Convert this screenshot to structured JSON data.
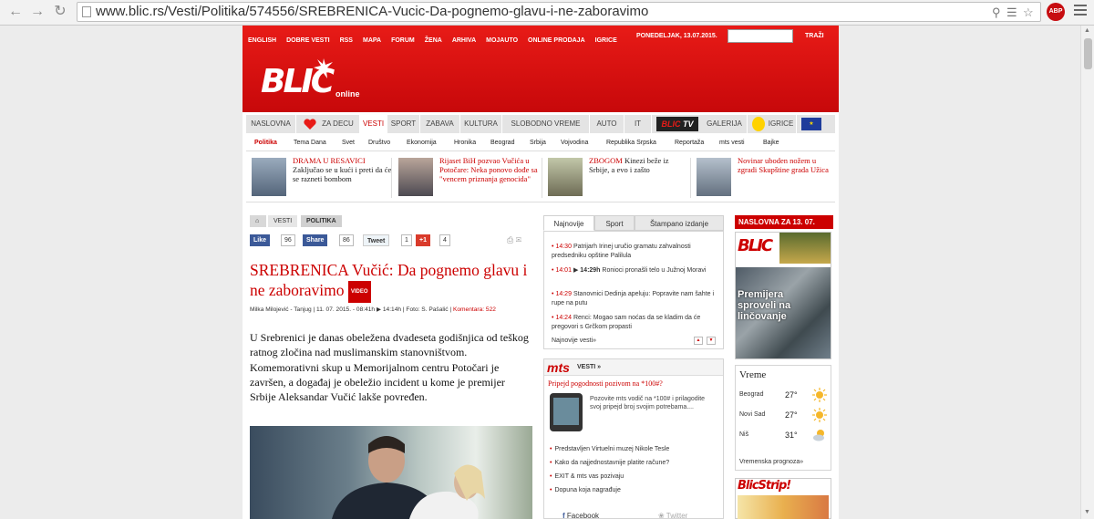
{
  "browser": {
    "url": "www.blic.rs/Vesti/Politika/574556/SREBRENICA-Vucic-Da-pognemo-glavu-i-ne-zaboravimo",
    "abp_label": "ABP"
  },
  "header": {
    "top_links": [
      "ENGLISH",
      "DOBRE VESTI",
      "RSS",
      "MAPA",
      "FORUM",
      "ŽENA",
      "ARHIVA",
      "MOJAUTO",
      "ONLINE PRODAJA",
      "IGRICE"
    ],
    "date": "PONEDELJAK, 13.07.2015.",
    "search_button": "TRAŽI",
    "logo": "BLIC",
    "logo_sub": "online"
  },
  "main_nav": {
    "items": [
      "NASLOVNA",
      "ZA DECU",
      "VESTI",
      "SPORT",
      "ZABAVA",
      "KULTURA",
      "SLOBODNO VREME",
      "AUTO",
      "IT",
      "GALERIJA",
      "IGRICE"
    ],
    "tv_label_red": "BLIC",
    "tv_label": "TV"
  },
  "sub_nav": {
    "items": [
      "Politika",
      "Tema Dana",
      "Svet",
      "Društvo",
      "Ekonomija",
      "Hronika",
      "Beograd",
      "Srbija",
      "Vojvodina",
      "Republika Srpska",
      "Reportaža",
      "mts vesti",
      "Bajke"
    ]
  },
  "top_stories": [
    {
      "headline": "DRAMA U RESAVICI",
      "rest": "Zaključao se u kući i preti da će se razneti bombom"
    },
    {
      "headline": "Rijaset BiH pozvao Vučića u Potočare: Neka ponovo dođe sa \"vencem priznanja genocida\"",
      "rest": ""
    },
    {
      "headline": "ZBOGOM",
      "rest": "Kinezi beže iz Srbije, a evo i zašto"
    },
    {
      "headline": "Novinar uboden nožem u zgradi Skupštine grada Užica",
      "rest": ""
    }
  ],
  "article": {
    "breadcrumb": [
      "VESTI",
      "POLITIKA"
    ],
    "social": {
      "like": "Like",
      "like_count": "96",
      "share": "Share",
      "share_count": "86",
      "tweet": "Tweet",
      "tweet_count": "1",
      "gplus": "+1",
      "gplus_count": "4"
    },
    "title": "SREBRENICA Vučić: Da pognemo glavu i ne zaboravimo",
    "video_badge": "VIDEO",
    "byline": "Milka Milojević - Tanjug | 11. 07. 2015. - 08:41h",
    "byline_time": "14:14h",
    "byline_photo": "| Foto: S. Pašalić |",
    "comments": "Komentara: 522",
    "lead": "U Srebrenici je danas obeležena dvadeseta godišnjica od teškog ratnog zločina nad muslimanskim stanovništvom. Komemorativni skup u Memorijalnom centru Potočari je završen, a događaj je obeležio incident u kome je premijer Srbije Aleksandar Vučić lakše povređen."
  },
  "news_tabs": [
    "Najnovije",
    "Sport",
    "Štampano izdanje"
  ],
  "latest_news": [
    {
      "time": "14:30",
      "text": "Patrijarh Irinej uručio gramatu zahvalnosti predsedniku opštine Palilula"
    },
    {
      "time": "14:01",
      "extra": "14:29h",
      "text": "Ronioci pronašli telo u Južnoj Moravi"
    },
    {
      "time": "14:29",
      "text": "Stanovnici Dedinja apeluju: Popravite nam šahte i rupe na putu"
    },
    {
      "time": "14:24",
      "text": "Renci: Mogao sam noćas da se kladim da će pregovori s Grčkom propasti"
    }
  ],
  "latest_footer": "Najnovije vesti»",
  "mts": {
    "logo": "mts",
    "section": "VESTI »",
    "feature_title": "Pripejd pogodnosti pozivom na *100#?",
    "feature_text": "Pozovite mts vodič na *100# i prilagodite svoj pripejd broj svojim potrebama....",
    "links": [
      "Predstavljen Virtuelni muzej Nikole Tesle",
      "Kako da najjednostavnije platite račune?",
      "EXIT & mts vas pozivaju",
      "Dopuna koja nagrađuje"
    ],
    "facebook": "Facebook",
    "twitter": "Twitter"
  },
  "front_page": {
    "heading": "NASLOVNA ZA 13. 07.",
    "np_logo": "BLIC",
    "np_headline": "Premijera sproveli na linčovanje"
  },
  "weather": {
    "title": "Vreme",
    "rows": [
      {
        "city": "Beograd",
        "temp": "27°"
      },
      {
        "city": "Novi Sad",
        "temp": "27°"
      },
      {
        "city": "Niš",
        "temp": "31°"
      }
    ],
    "link": "Vremenska prognoza»"
  },
  "blicstrip": "BlicStrip!"
}
